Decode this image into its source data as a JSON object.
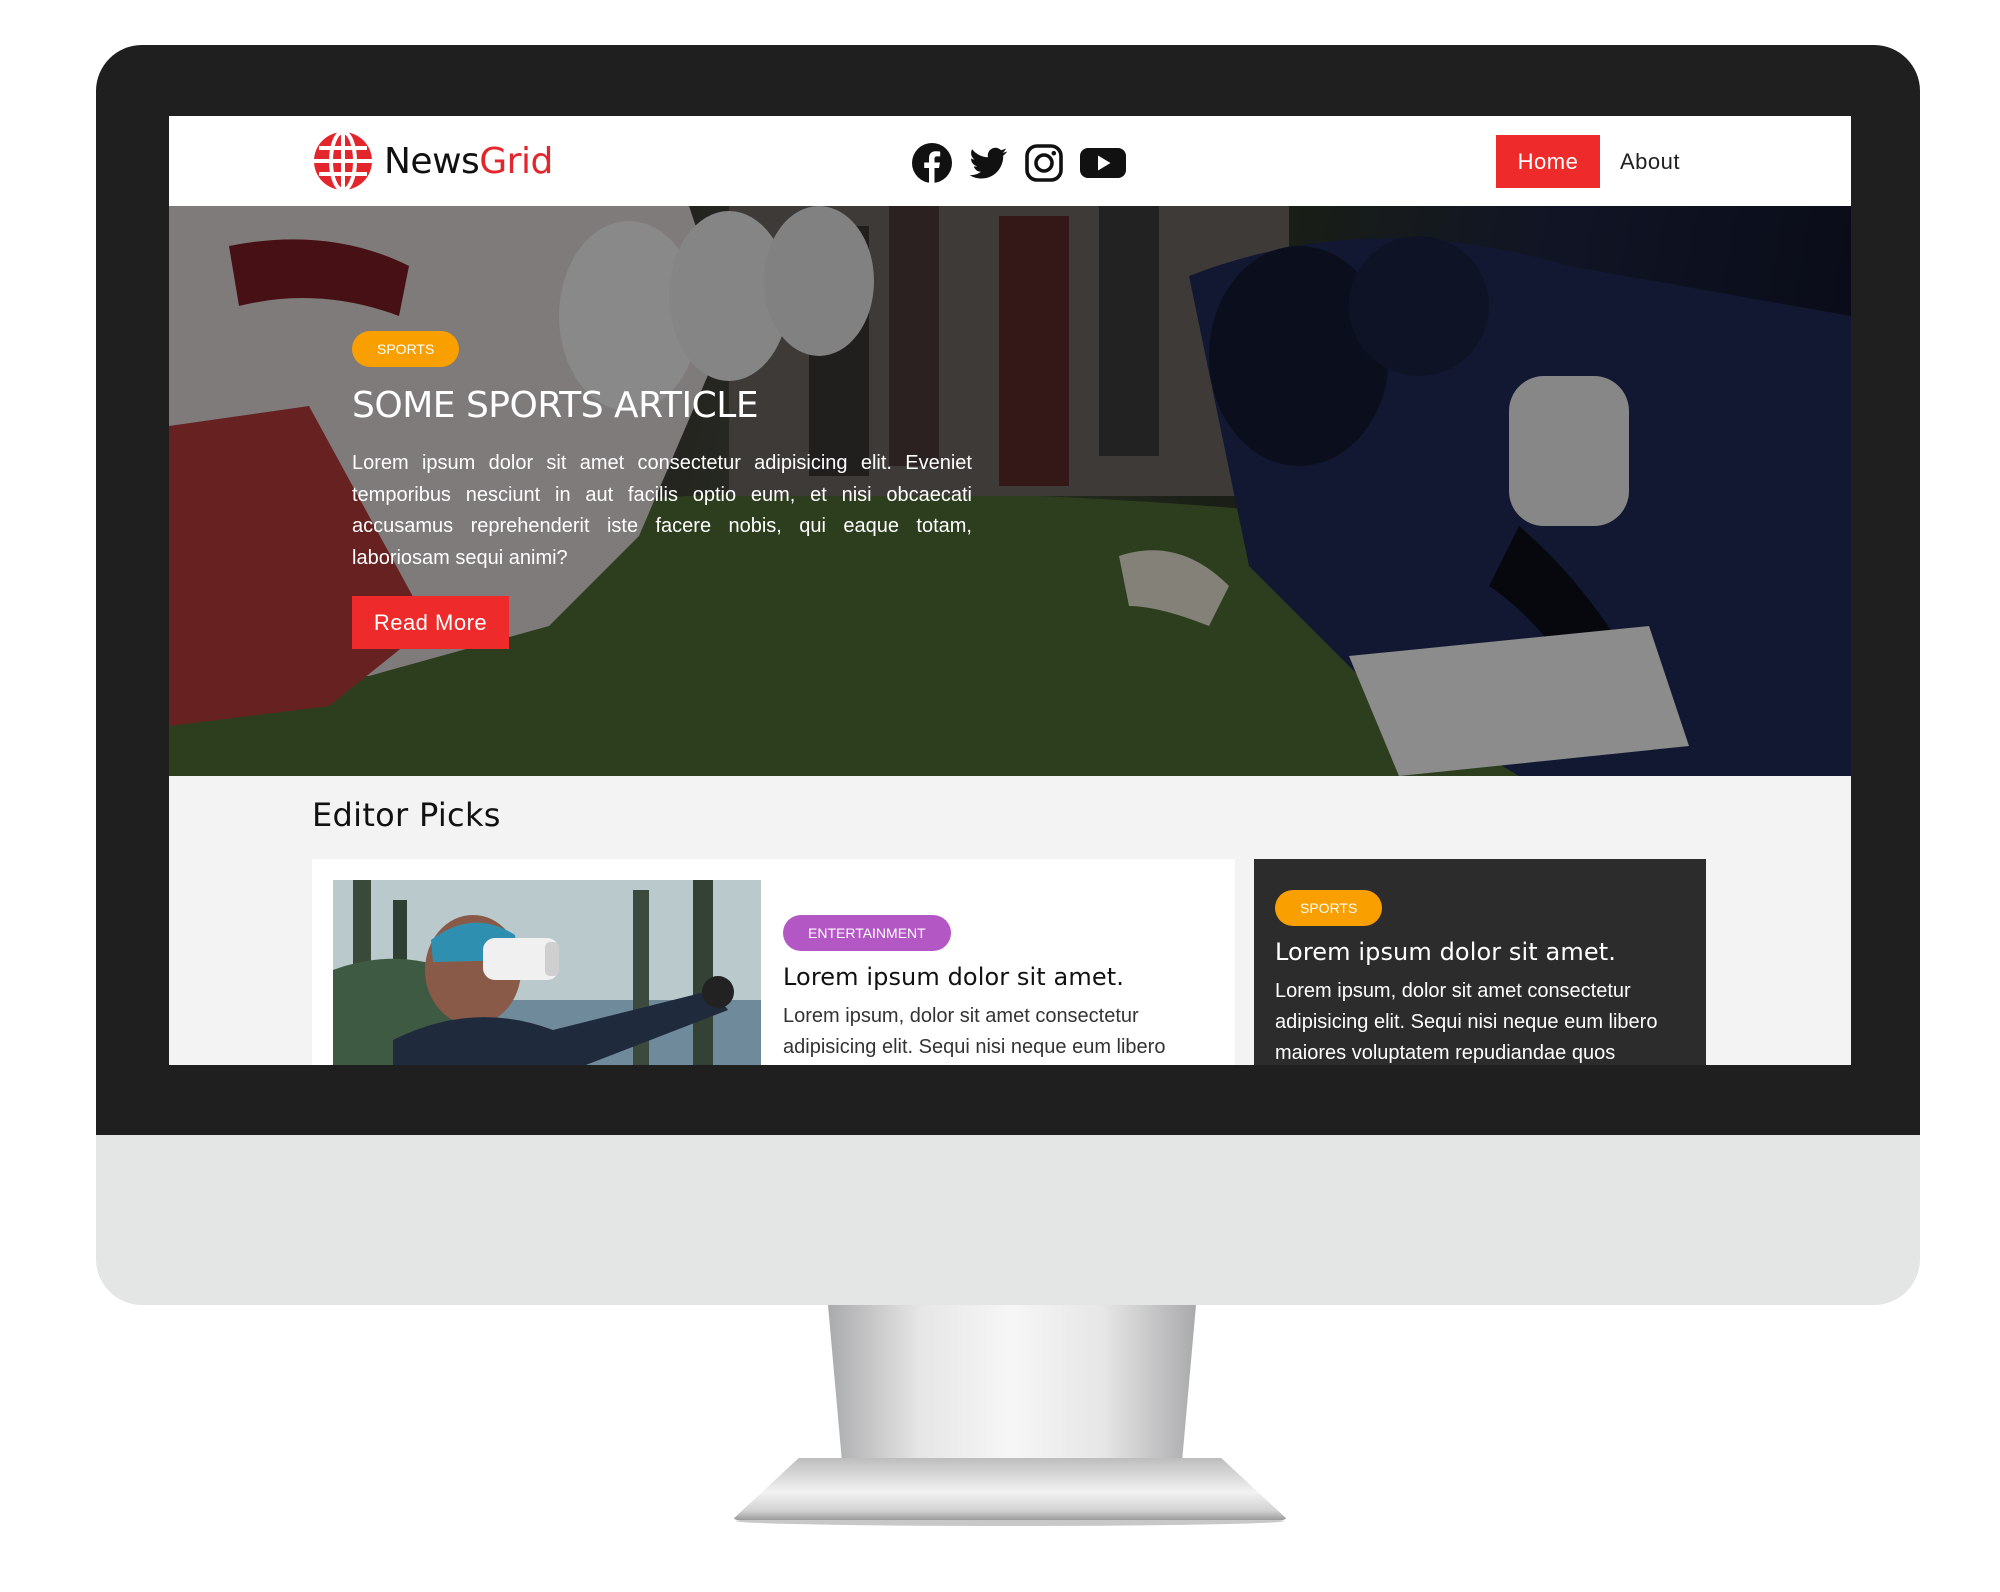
{
  "header": {
    "logo": {
      "brand_first": "News",
      "brand_second": "Grid"
    },
    "social": [
      "facebook-icon",
      "twitter-icon",
      "instagram-icon",
      "youtube-icon"
    ],
    "nav": {
      "home": "Home",
      "about": "About"
    }
  },
  "hero": {
    "category": "SPORTS",
    "title": "SOME SPORTS ARTICLE",
    "text": "Lorem ipsum dolor sit amet consectetur adipisicing elit. Eveniet temporibus nesciunt in aut facilis optio eum, et nisi obcaecati accusamus reprehenderit iste facere nobis, qui eaque totam, laboriosam sequi animi?",
    "button": "Read More"
  },
  "editor_picks": {
    "heading": "Editor Picks",
    "main_card": {
      "category": "ENTERTAINMENT",
      "title": "Lorem ipsum dolor sit amet.",
      "text": "Lorem ipsum, dolor sit amet consectetur adipisicing elit. Sequi nisi neque eum libero"
    },
    "side_card": {
      "category": "SPORTS",
      "title": "Lorem ipsum dolor sit amet.",
      "text": "Lorem ipsum, dolor sit amet consectetur adipisicing elit. Sequi nisi neque eum libero maiores voluptatem repudiandae quos"
    }
  },
  "colors": {
    "accent_red": "#ee2a2a",
    "sports_badge": "#f9a000",
    "entertainment_badge": "#b357c4",
    "dark_card": "#2c2c2c",
    "bezel": "#1f1f1f"
  }
}
